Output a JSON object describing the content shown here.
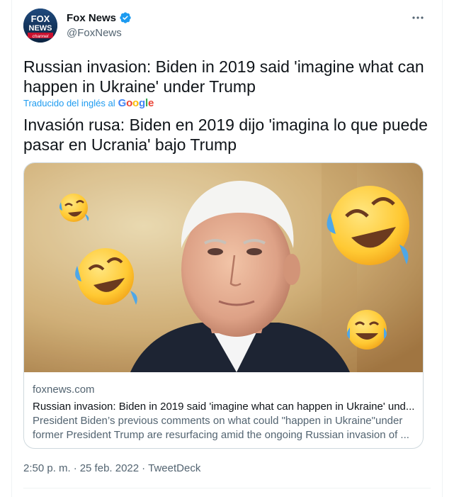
{
  "author": {
    "name": "Fox News",
    "handle": "@FoxNews",
    "verified": true,
    "logo_text_top": "FOX",
    "logo_text_mid": "NEWS",
    "logo_text_bottom": "channel"
  },
  "tweet": {
    "text": "Russian invasion: Biden in 2019 said 'imagine what can happen in Ukraine' under Trump",
    "translated_label": "Traducido del inglés al",
    "translator": "Google",
    "translation": "Invasión rusa: Biden en 2019 dijo 'imagina lo que puede pasar en Ucrania' bajo Trump"
  },
  "link_card": {
    "domain": "foxnews.com",
    "title": "Russian invasion: Biden in 2019 said 'imagine what can happen in Ukraine' und...",
    "description": "President Biden’s previous comments on what could \"happen in Ukraine\"under former President Trump are resurfacing amid the ongoing Russian invasion of ..."
  },
  "meta": {
    "time": "2:50 p. m.",
    "separator": "·",
    "date": "25 feb. 2022",
    "source": "TweetDeck"
  },
  "icons": {
    "more": "more-horizontal-icon",
    "verified": "verified-badge-icon",
    "emoji": "rolling-laughing-emoji"
  },
  "colors": {
    "accent": "#1d9bf0",
    "secondary_text": "#536471",
    "border": "#cfd9de"
  }
}
